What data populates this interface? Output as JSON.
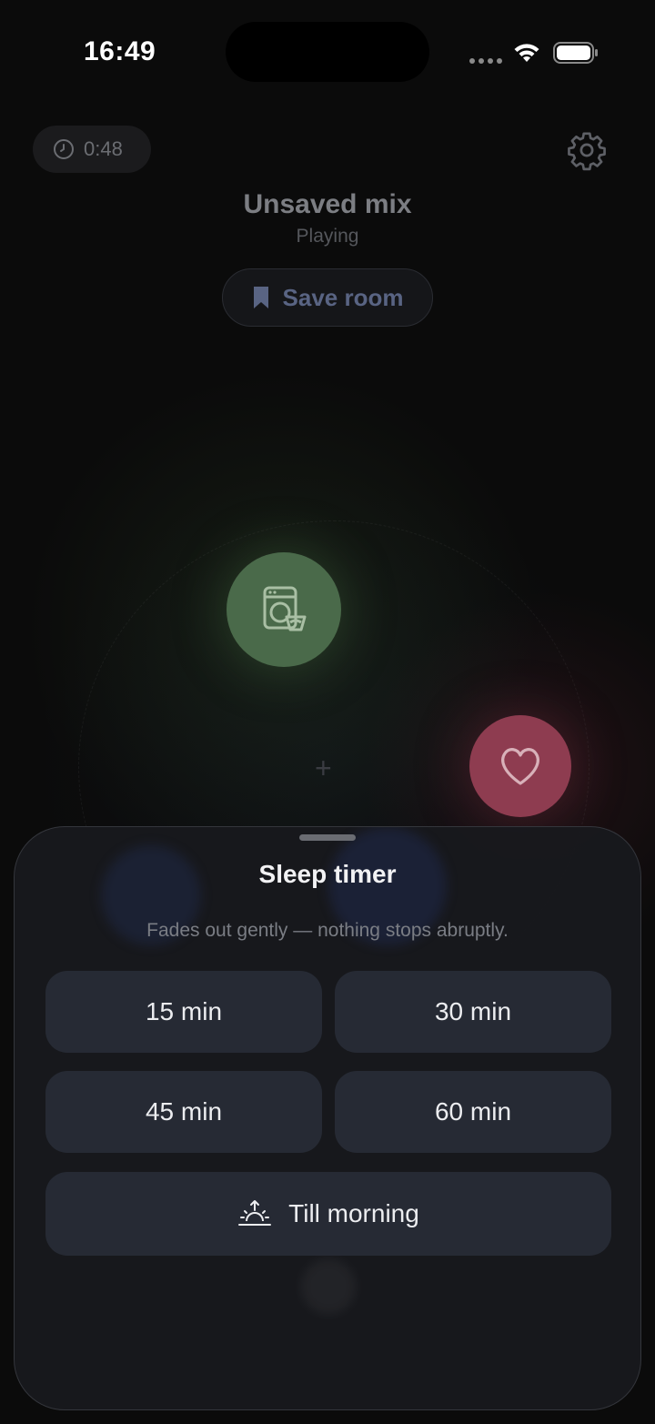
{
  "status_bar": {
    "time": "16:49"
  },
  "header": {
    "timer_chip": "0:48",
    "mix_title": "Unsaved mix",
    "mix_status": "Playing",
    "save_label": "Save room"
  },
  "orbs": {
    "plus": "+",
    "colors": {
      "washer": "#4a6a4a",
      "heart": "#8e3c50"
    },
    "icons": [
      "washing-machine-icon",
      "heart-icon"
    ]
  },
  "sheet": {
    "title": "Sleep timer",
    "subtitle": "Fades out gently — nothing stops abruptly.",
    "options": [
      "15 min",
      "30 min",
      "45 min",
      "60 min"
    ],
    "morning_label": "Till morning"
  }
}
